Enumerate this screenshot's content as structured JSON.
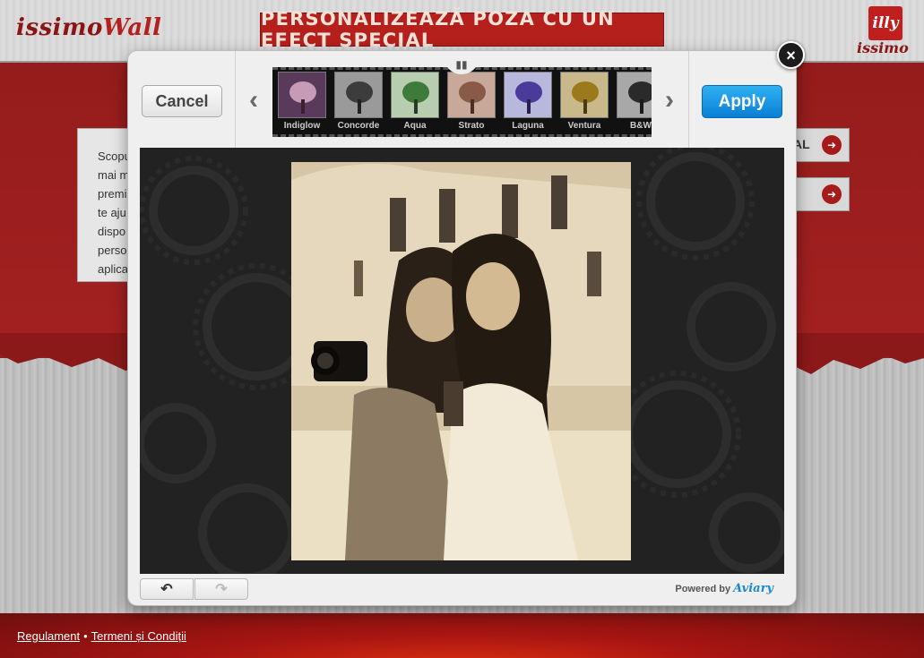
{
  "site": {
    "logo_part1": "issimo",
    "logo_part2": "Wall",
    "banner": "PERSONALIZEAZĂ POZA CU UN EFECT SPECIAL",
    "brand_logo": "illy",
    "brand_sublogo": "issimo"
  },
  "background": {
    "text_lines": [
      "Scopul",
      "mai m",
      "premi",
      "te aju",
      "dispo",
      "perso",
      "aplica"
    ],
    "buttons": [
      {
        "label": "AL"
      },
      {
        "label": ""
      }
    ]
  },
  "editor": {
    "cancel_label": "Cancel",
    "apply_label": "Apply",
    "close_glyph": "×",
    "prev_glyph": "‹",
    "next_glyph": "›",
    "filters": [
      {
        "label": "Indiglow",
        "bg": "#5a3a5a",
        "tree": "#c79ab5",
        "trunk": "#3a1f30"
      },
      {
        "label": "Concorde",
        "bg": "#9a9a9a",
        "tree": "#3c3c3c",
        "trunk": "#222222"
      },
      {
        "label": "Aqua",
        "bg": "#b8cdb0",
        "tree": "#3e7a3a",
        "trunk": "#2a3a2a"
      },
      {
        "label": "Strato",
        "bg": "#c8a898",
        "tree": "#8a5a48",
        "trunk": "#4a2e24"
      },
      {
        "label": "Laguna",
        "bg": "#b8b8dc",
        "tree": "#4a3a9a",
        "trunk": "#2a2050"
      },
      {
        "label": "Ventura",
        "bg": "#c8b88a",
        "tree": "#9a7a1a",
        "trunk": "#4a3a10"
      },
      {
        "label": "B&W",
        "bg": "#a8a8a8",
        "tree": "#2a2a2a",
        "trunk": "#1a1a1a"
      }
    ],
    "undo_glyph": "↶",
    "redo_glyph": "↷",
    "powered_by": "Powered by",
    "powered_brand": "Aviary"
  },
  "footer": {
    "link1": "Regulament",
    "separator": "•",
    "link2": "Termeni și Condiții"
  },
  "colors": {
    "accent_red": "#b51f1c",
    "apply_blue": "#0a7fd6",
    "canvas_dark": "#222222",
    "sepia_light": "#efe6cf"
  }
}
